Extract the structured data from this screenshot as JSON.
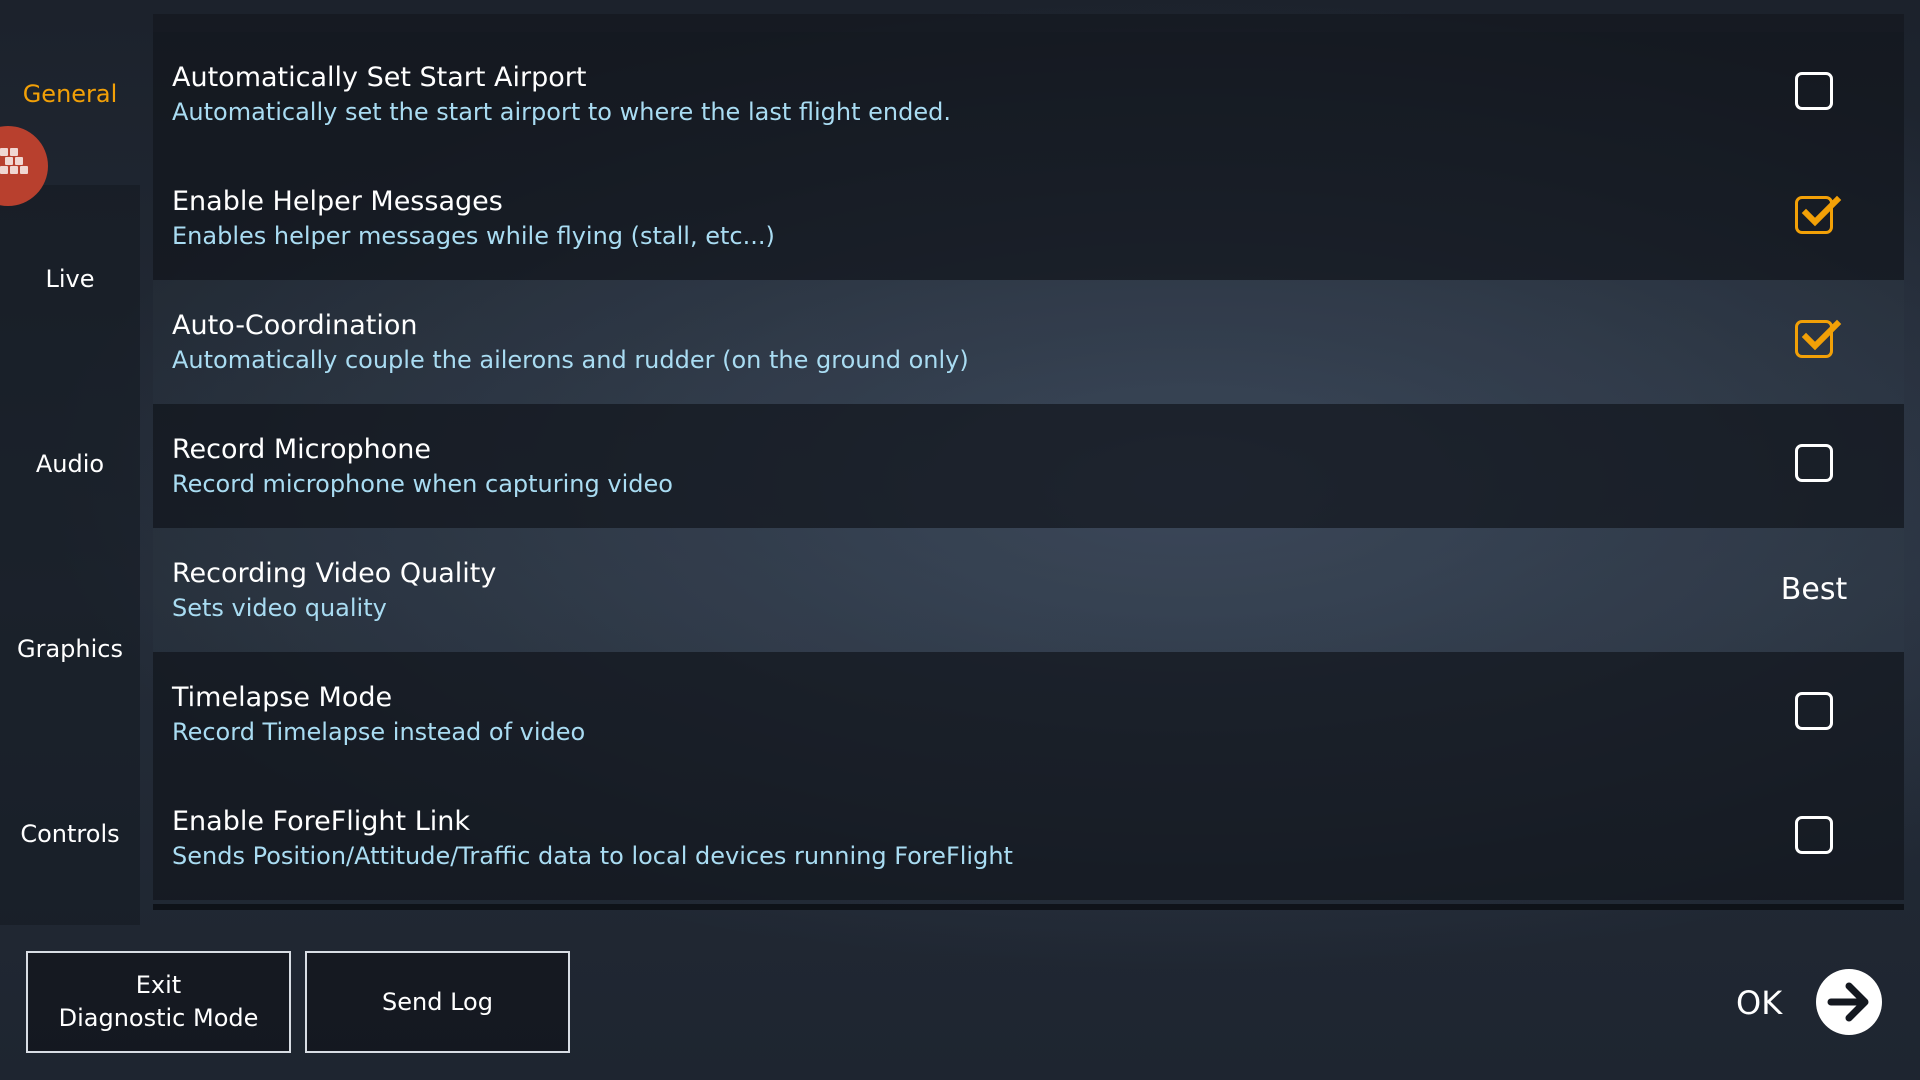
{
  "sidebar": {
    "items": [
      {
        "label": "General",
        "active": true
      },
      {
        "label": "Live",
        "active": false
      },
      {
        "label": "Audio",
        "active": false
      },
      {
        "label": "Graphics",
        "active": false
      },
      {
        "label": "Controls",
        "active": false
      }
    ]
  },
  "settings": [
    {
      "title": "Automatically Set Start Airport",
      "description": "Automatically set the start airport to where the last flight ended.",
      "control": "checkbox",
      "checked": false
    },
    {
      "title": "Enable Helper Messages",
      "description": "Enables helper messages while flying (stall, etc...)",
      "control": "checkbox",
      "checked": true
    },
    {
      "title": "Auto-Coordination",
      "description": "Automatically couple the ailerons and rudder (on the ground only)",
      "control": "checkbox",
      "checked": true
    },
    {
      "title": "Record Microphone",
      "description": "Record microphone when capturing video",
      "control": "checkbox",
      "checked": false
    },
    {
      "title": "Recording Video Quality",
      "description": "Sets video quality",
      "control": "value",
      "value": "Best"
    },
    {
      "title": "Timelapse Mode",
      "description": "Record Timelapse instead of video",
      "control": "checkbox",
      "checked": false
    },
    {
      "title": "Enable ForeFlight Link",
      "description": "Sends Position/Attitude/Traffic data to local devices running ForeFlight",
      "control": "checkbox",
      "checked": false
    }
  ],
  "footer": {
    "exit_line1": "Exit",
    "exit_line2": "Diagnostic Mode",
    "send_log": "Send Log",
    "ok": "OK"
  },
  "icons": {
    "ok": "arrow-right-circle-icon",
    "check": "checkmark-icon",
    "badge": "pixel-logo-icon"
  },
  "colors": {
    "accent": "#f2a007",
    "description": "#a9dcf2",
    "badge": "#b8402e"
  }
}
